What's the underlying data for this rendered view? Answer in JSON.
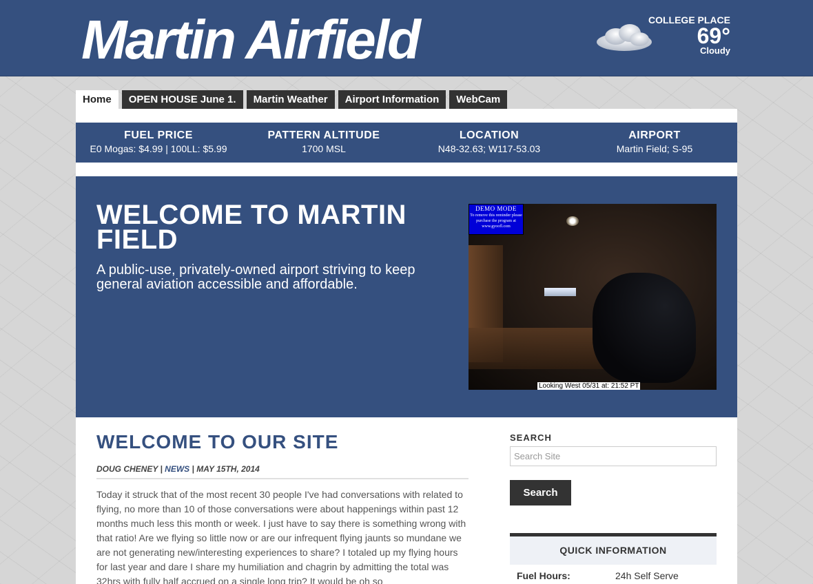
{
  "header": {
    "logo": "Martin Airfield",
    "weather": {
      "place": "COLLEGE PLACE",
      "temp": "69°",
      "condition": "Cloudy",
      "icon": "cloud-icon"
    }
  },
  "nav": {
    "tabs": [
      {
        "label": "Home",
        "active": true
      },
      {
        "label": "OPEN HOUSE June 1.",
        "active": false
      },
      {
        "label": "Martin Weather",
        "active": false
      },
      {
        "label": "Airport Information",
        "active": false
      },
      {
        "label": "WebCam",
        "active": false
      }
    ]
  },
  "infobar": [
    {
      "heading": "FUEL PRICE",
      "value": "E0 Mogas: $4.99 | 100LL: $5.99"
    },
    {
      "heading": "PATTERN ALTITUDE",
      "value": "1700 MSL"
    },
    {
      "heading": "LOCATION",
      "value": "N48-32.63; W117-53.03"
    },
    {
      "heading": "AIRPORT",
      "value": "Martin Field; S-95"
    }
  ],
  "hero": {
    "title": "WELCOME TO MARTIN FIELD",
    "subtitle": "A public-use, privately-owned airport striving to keep general aviation accessible and affordable.",
    "webcam": {
      "demo_title": "DEMO MODE",
      "demo_text": "To remove this reminder please purchase the program at www.gyoofl.com",
      "caption": "Looking West  05/31 at: 21:52 PT"
    }
  },
  "article": {
    "title": "WELCOME TO OUR SITE",
    "author": "DOUG CHENEY",
    "category": "NEWS",
    "date": "MAY 15TH, 2014",
    "sep": " | ",
    "body": "Today it struck that of the most recent 30 people I've had conversations with related to flying, no more than 10 of those conversations were about happenings within past 12 months much less this month or week. I just have to say there is something wrong with that ratio! Are we flying so little now or are our infrequent flying jaunts so mundane we are not generating new/interesting experiences to share? I totaled up my flying hours for last year and dare I share my humiliation and chagrin by admitting the total was 32hrs with fully half accrued on a single long trip? It would be oh so"
  },
  "sidebar": {
    "search_title": "SEARCH",
    "search_placeholder": "Search Site",
    "search_button": "Search",
    "quick_info_title": "QUICK INFORMATION",
    "quick_info": [
      {
        "key": "Fuel Hours:",
        "value": "24h Self Serve"
      }
    ]
  }
}
